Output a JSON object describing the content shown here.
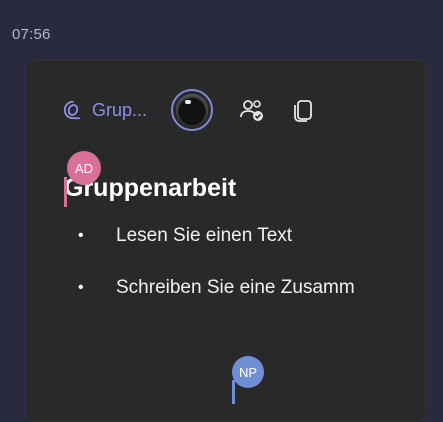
{
  "meta": {
    "time": "07:56"
  },
  "toolbar": {
    "loop_label": "Grup...",
    "loop_icon": "loop-component-icon",
    "avatar_icon": "user-avatar",
    "participants_icon": "people-check-icon",
    "copy_icon": "copy-icon",
    "accent": "#8b8fe8"
  },
  "document": {
    "heading": "Gruppenarbeit",
    "bullets": [
      "Lesen Sie einen Text",
      "Schreiben Sie eine Zusamm"
    ]
  },
  "collaborators": [
    {
      "initials": "AD",
      "color": "#d9709a"
    },
    {
      "initials": "NP",
      "color": "#6e8fd6"
    }
  ]
}
